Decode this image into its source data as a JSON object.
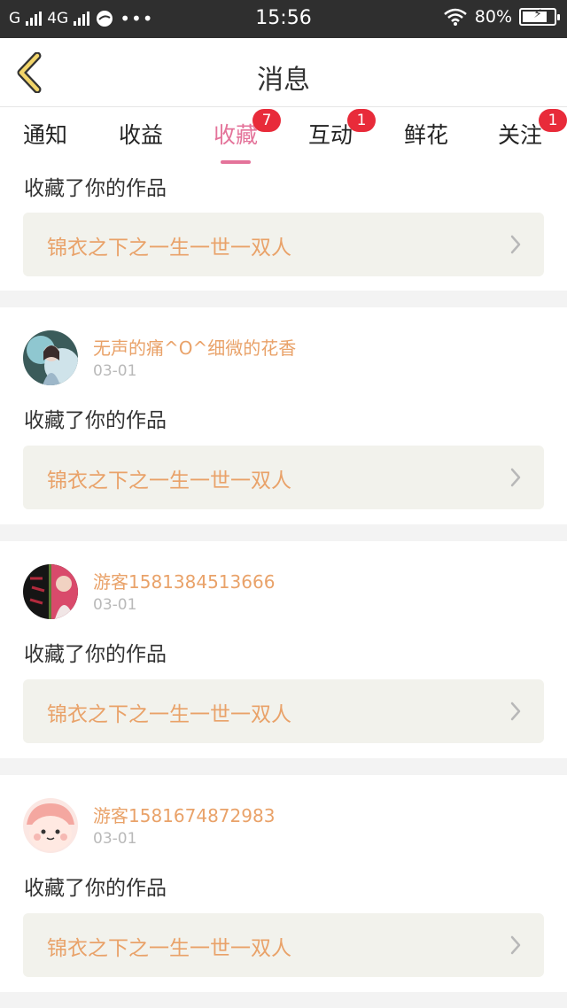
{
  "status_bar": {
    "carrier_left": "G",
    "network": "4G",
    "time": "15:56",
    "battery_percent": "80%",
    "battery_level": 0.8
  },
  "header": {
    "title": "消息",
    "back_icon": "chevron-left-icon"
  },
  "tabs": [
    {
      "label": "通知",
      "badge": ""
    },
    {
      "label": "收益",
      "badge": ""
    },
    {
      "label": "收藏",
      "badge": "7",
      "active": true
    },
    {
      "label": "互动",
      "badge": "1"
    },
    {
      "label": "鲜花",
      "badge": ""
    },
    {
      "label": "关注",
      "badge": "1"
    }
  ],
  "colors": {
    "accent": "#e4739a",
    "name": "#e9a269",
    "badge": "#e82b3a"
  },
  "notifications": [
    {
      "action": "收藏了你的作品",
      "work": "锦衣之下之一生一世一双人"
    },
    {
      "user": "无声的痛^O^细微的花香",
      "date": "03-01",
      "action": "收藏了你的作品",
      "work": "锦衣之下之一生一世一双人"
    },
    {
      "user": "游客1581384513666",
      "date": "03-01",
      "action": "收藏了你的作品",
      "work": "锦衣之下之一生一世一双人"
    },
    {
      "user": "游客1581674872983",
      "date": "03-01",
      "action": "收藏了你的作品",
      "work": "锦衣之下之一生一世一双人"
    }
  ]
}
